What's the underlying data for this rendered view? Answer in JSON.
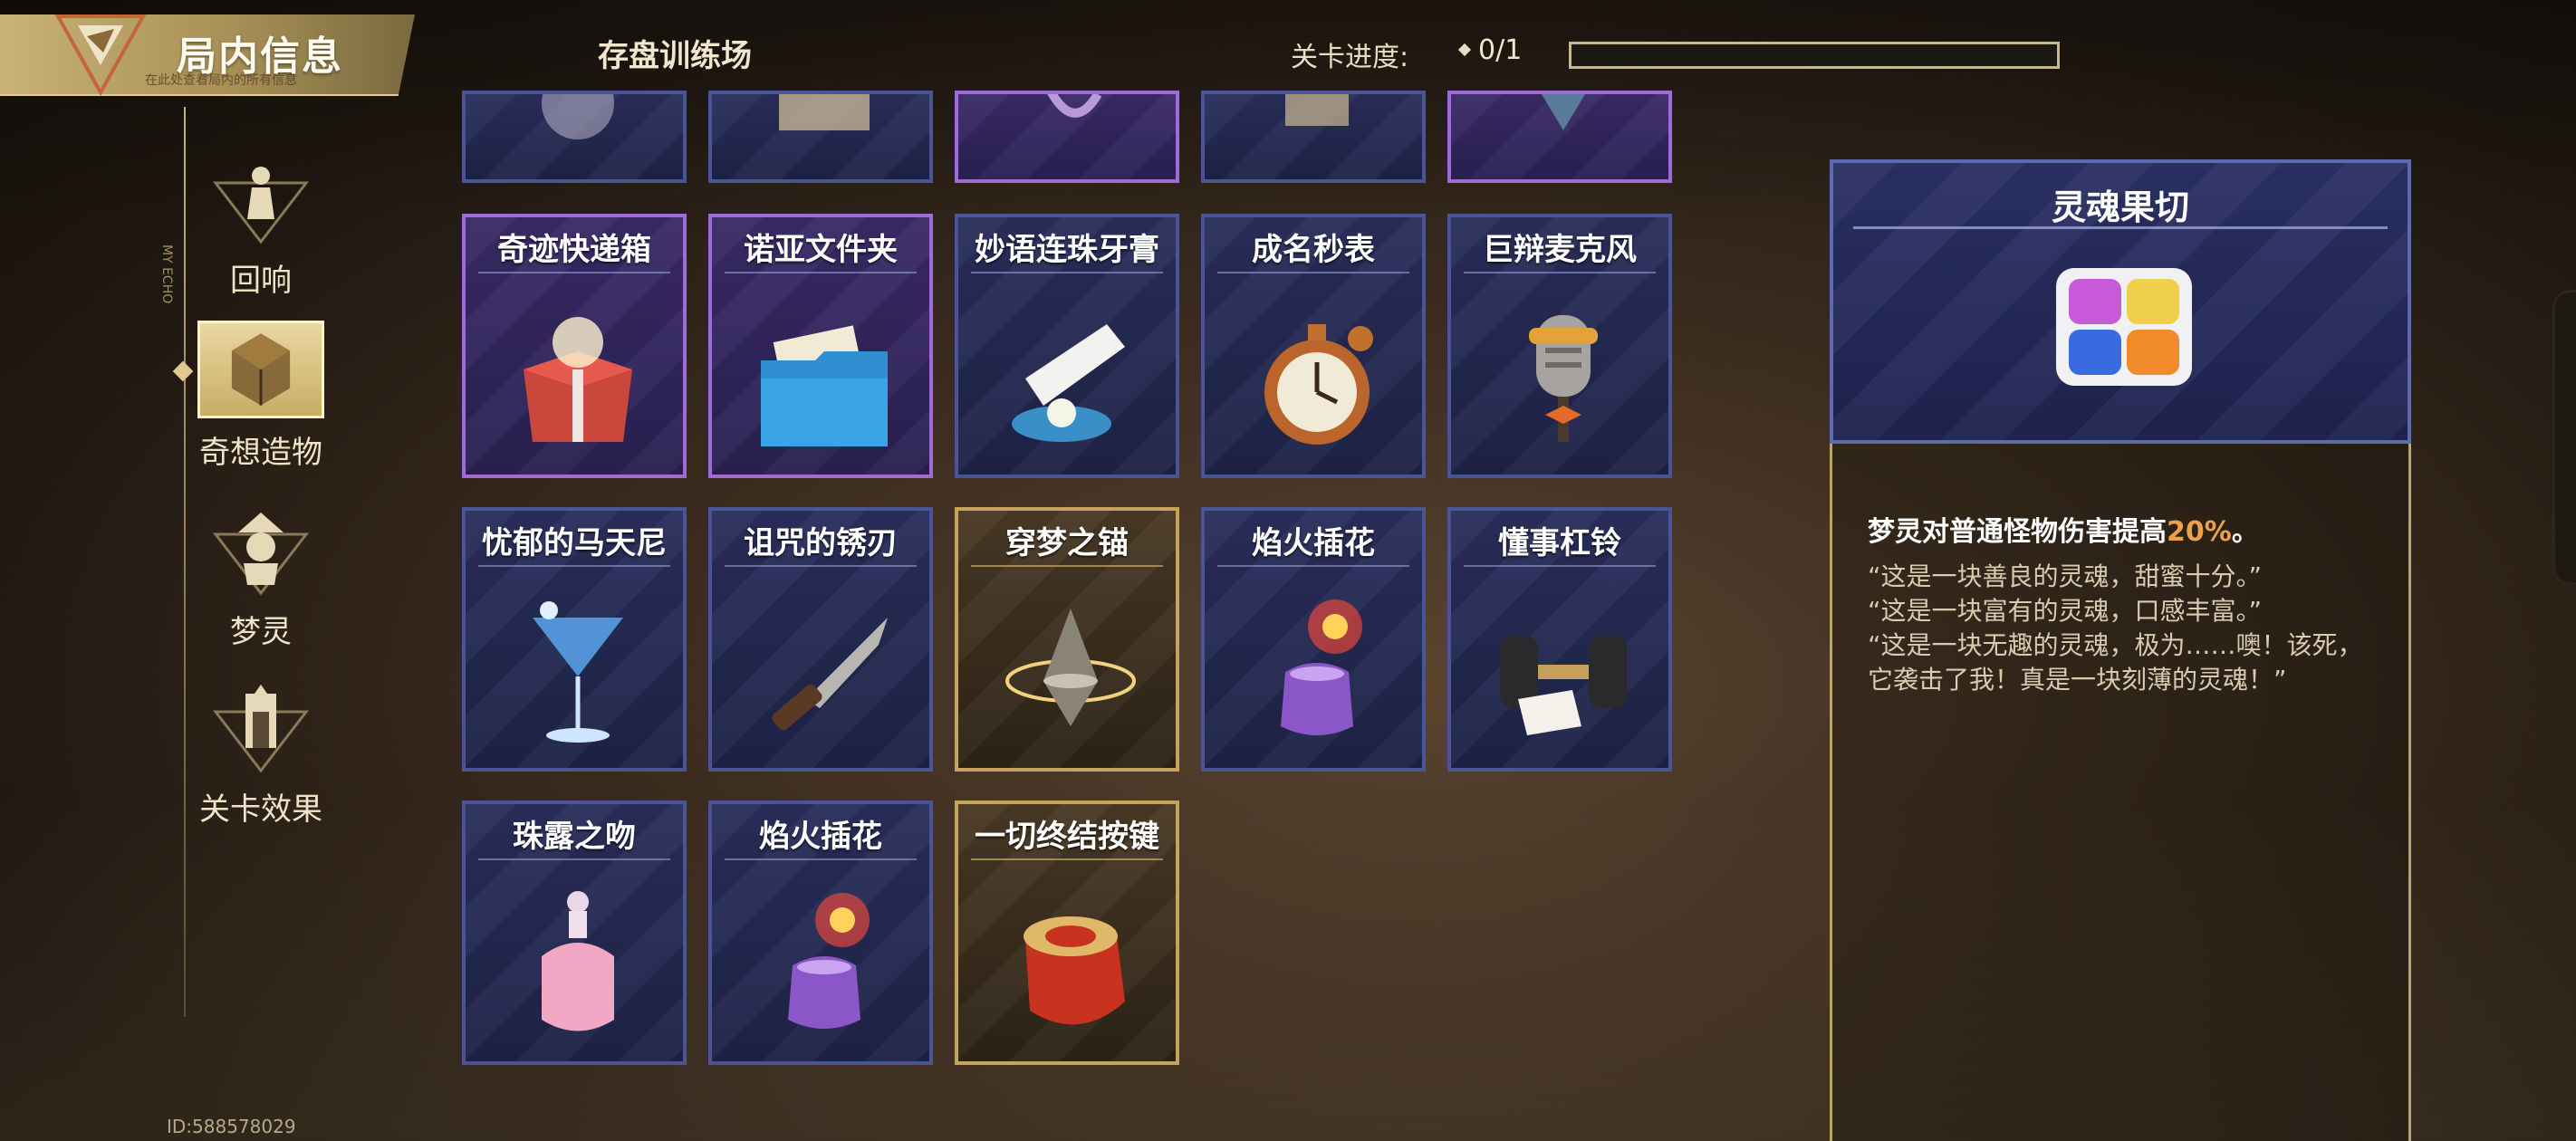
{
  "header": {
    "title": "局内信息",
    "title_subtext": "在此处查看局内的所有信息",
    "level_name": "存盘训练场",
    "progress_label": "关卡进度:",
    "progress_value": "0/1",
    "progress_fraction": 0
  },
  "nav": {
    "items": [
      {
        "label": "回响",
        "icon": "echo-icon",
        "active": false
      },
      {
        "label": "奇想造物",
        "icon": "artifact-icon",
        "active": true
      },
      {
        "label": "梦灵",
        "icon": "dream-spirit-icon",
        "active": false
      },
      {
        "label": "关卡效果",
        "icon": "level-effect-icon",
        "active": false
      }
    ],
    "deco_text": "MY ECHO"
  },
  "grid": {
    "partial_row": [
      {
        "rarity": "blue"
      },
      {
        "rarity": "blue"
      },
      {
        "rarity": "purple"
      },
      {
        "rarity": "blue"
      },
      {
        "rarity": "purple"
      }
    ],
    "rows": [
      [
        {
          "name": "奇迹快递箱",
          "rarity": "purple",
          "icon": "gift-box-icon"
        },
        {
          "name": "诺亚文件夹",
          "rarity": "purple",
          "icon": "folder-icon"
        },
        {
          "name": "妙语连珠牙膏",
          "rarity": "blue",
          "icon": "toothpaste-icon"
        },
        {
          "name": "成名秒表",
          "rarity": "blue",
          "icon": "stopwatch-icon"
        },
        {
          "name": "巨辩麦克风",
          "rarity": "blue",
          "icon": "microphone-icon"
        }
      ],
      [
        {
          "name": "忧郁的马天尼",
          "rarity": "blue",
          "icon": "martini-icon"
        },
        {
          "name": "诅咒的锈刃",
          "rarity": "blue",
          "icon": "knife-icon"
        },
        {
          "name": "穿梦之锚",
          "rarity": "gold",
          "icon": "spinning-top-icon"
        },
        {
          "name": "焰火插花",
          "rarity": "blue",
          "icon": "firework-vase-icon"
        },
        {
          "name": "懂事杠铃",
          "rarity": "blue",
          "icon": "dumbbell-icon"
        }
      ],
      [
        {
          "name": "珠露之吻",
          "rarity": "blue",
          "icon": "perfume-icon"
        },
        {
          "name": "焰火插花",
          "rarity": "blue",
          "icon": "firework-vase-icon"
        },
        {
          "name": "一切终结按键",
          "rarity": "gold",
          "icon": "red-button-icon"
        }
      ]
    ]
  },
  "detail": {
    "title": "灵魂果切",
    "icon": "fruit-jelly-icon",
    "effect_prefix": "梦灵对普通怪物伤害提高",
    "effect_value": "20%",
    "effect_suffix": "。",
    "quote": "“这是一块善良的灵魂，甜蜜十分。”\n“这是一块富有的灵魂，口感丰富。”\n“这是一块无趣的灵魂，极为……噢！该死，它袭击了我！真是一块刻薄的灵魂！”"
  },
  "footer": {
    "player_id": "ID:588578029"
  },
  "colors": {
    "rarity_blue": "#4a5596",
    "rarity_purple": "#a06bd6",
    "rarity_gold": "#c7a45c",
    "highlight": "#f0a04a"
  }
}
